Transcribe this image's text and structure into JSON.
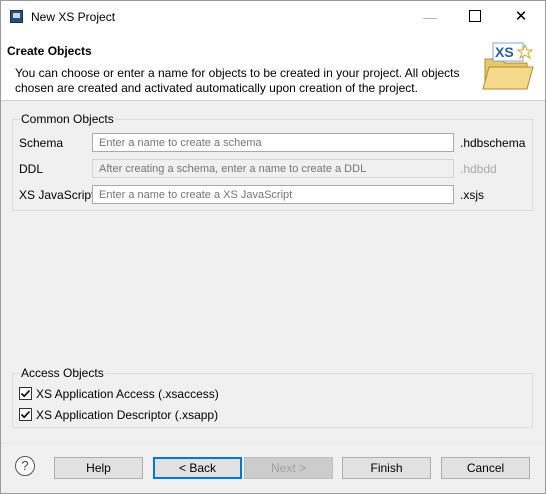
{
  "window": {
    "title": "New XS Project",
    "minimize": "—",
    "close": "✕"
  },
  "header": {
    "title": "Create Objects",
    "description": "You can choose or enter a name for objects to be created in your project. All objects chosen are created and activated automatically upon creation of the project.",
    "banner_text": "XS"
  },
  "common_objects": {
    "label": "Common Objects",
    "rows": [
      {
        "label": "Schema",
        "placeholder": "Enter a name to create a schema",
        "suffix": ".hdbschema",
        "enabled": true
      },
      {
        "label": "DDL",
        "placeholder": "After creating a schema, enter a name to create a DDL",
        "suffix": ".hdbdd",
        "enabled": false
      },
      {
        "label": "XS JavaScript",
        "placeholder": "Enter a name to create a XS JavaScript",
        "suffix": ".xsjs",
        "enabled": true
      }
    ]
  },
  "access_objects": {
    "label": "Access Objects",
    "items": [
      {
        "label": "XS Application Access (.xsaccess)",
        "checked": true
      },
      {
        "label": "XS Application Descriptor (.xsapp)",
        "checked": true
      }
    ]
  },
  "footer": {
    "help_icon": "?",
    "buttons": {
      "help": "Help",
      "back": "< Back",
      "next": "Next >",
      "finish": "Finish",
      "cancel": "Cancel"
    }
  },
  "colors": {
    "accent": "#0078d7",
    "banner_gold": "#e8c66a"
  }
}
